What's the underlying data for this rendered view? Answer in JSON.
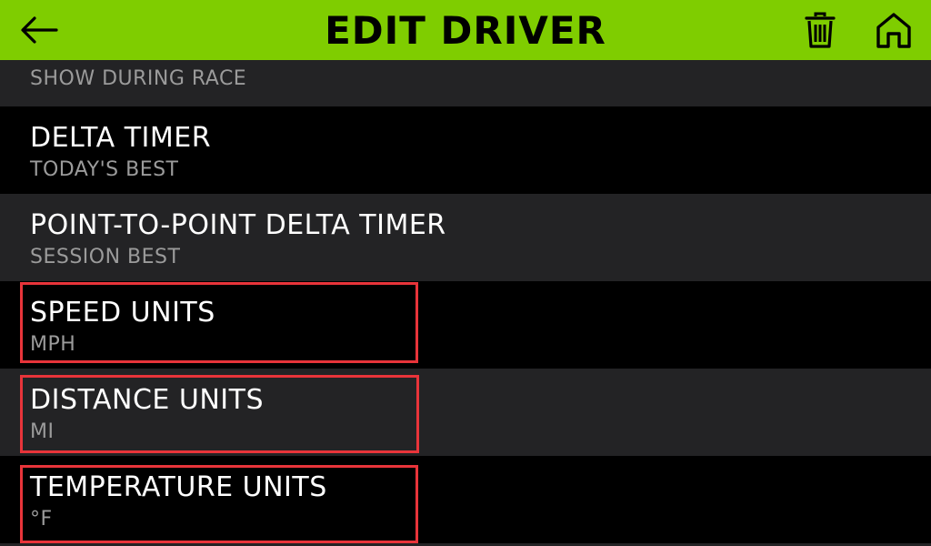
{
  "header": {
    "title": "EDIT DRIVER",
    "back_icon": "arrow-left-icon",
    "delete_icon": "trash-icon",
    "home_icon": "home-icon",
    "background_color": "#7fcd00"
  },
  "settings": {
    "partial_value": "SHOW DURING RACE",
    "rows": [
      {
        "label": "DELTA TIMER",
        "value": "TODAY'S BEST"
      },
      {
        "label": "POINT-TO-POINT DELTA TIMER",
        "value": "SESSION BEST"
      },
      {
        "label": "SPEED UNITS",
        "value": "MPH"
      },
      {
        "label": "DISTANCE UNITS",
        "value": "MI"
      },
      {
        "label": "TEMPERATURE UNITS",
        "value": "°F"
      }
    ]
  },
  "colors": {
    "highlight": "#e8343a",
    "row_alt": "#232325",
    "text_primary": "#ffffff",
    "text_secondary": "#9b9b9b"
  }
}
